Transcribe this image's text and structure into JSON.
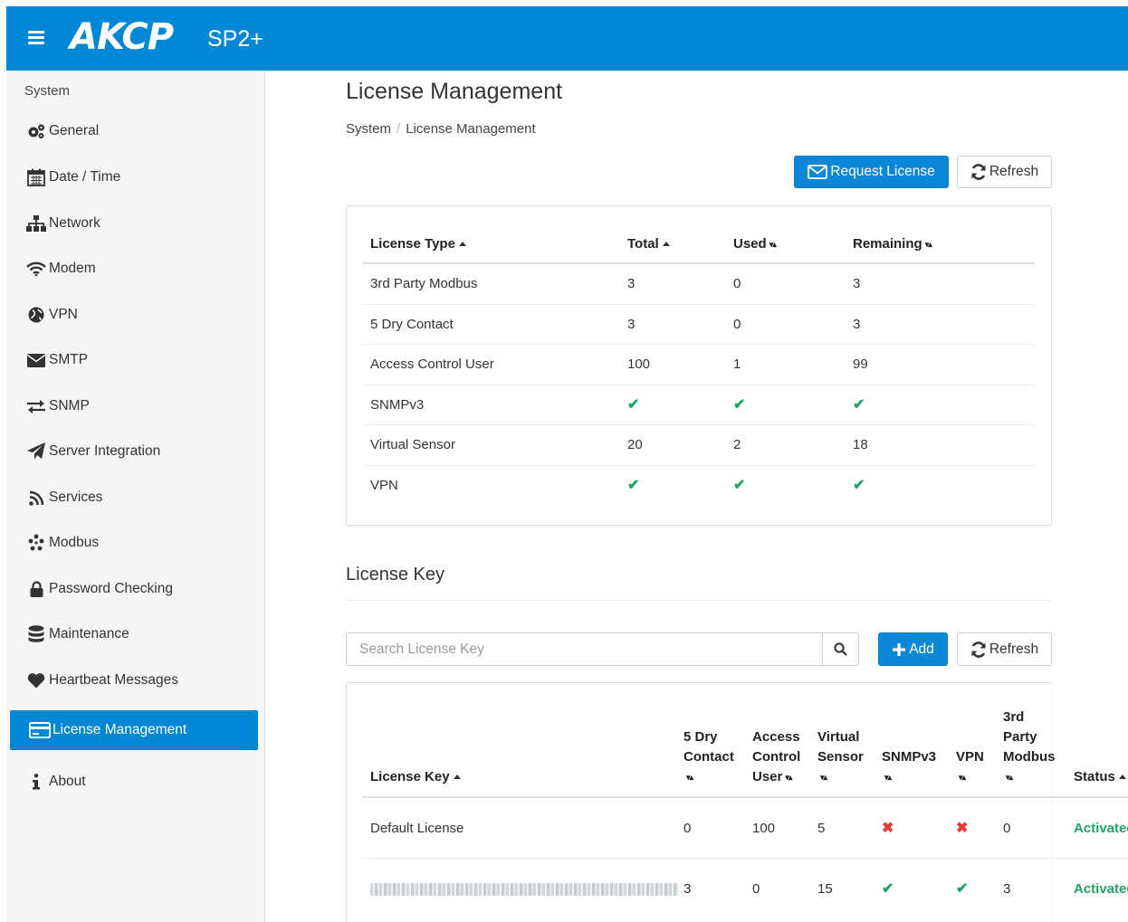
{
  "header": {
    "logo": "AKCP",
    "product": "SP2+"
  },
  "sidebar": {
    "heading": "System",
    "items": [
      {
        "label": "General",
        "icon": "gears-icon"
      },
      {
        "label": "Date / Time",
        "icon": "calendar-icon"
      },
      {
        "label": "Network",
        "icon": "sitemap-icon"
      },
      {
        "label": "Modem",
        "icon": "wifi-icon"
      },
      {
        "label": "VPN",
        "icon": "globe-icon"
      },
      {
        "label": "SMTP",
        "icon": "envelope-icon"
      },
      {
        "label": "SNMP",
        "icon": "exchange-icon"
      },
      {
        "label": "Server Integration",
        "icon": "paper-plane-icon"
      },
      {
        "label": "Services",
        "icon": "rss-icon"
      },
      {
        "label": "Modbus",
        "icon": "modbus-icon"
      },
      {
        "label": "Password Checking",
        "icon": "lock-icon"
      },
      {
        "label": "Maintenance",
        "icon": "database-icon"
      },
      {
        "label": "Heartbeat Messages",
        "icon": "heart-icon"
      },
      {
        "label": "License Management",
        "icon": "credit-card-icon",
        "active": true
      },
      {
        "label": "About",
        "icon": "info-icon"
      }
    ]
  },
  "page": {
    "title": "License Management",
    "breadcrumb": [
      "System",
      "License Management"
    ],
    "request_license": "Request License",
    "refresh": "Refresh"
  },
  "license_table": {
    "headers": [
      "License Type",
      "Total",
      "Used",
      "Remaining"
    ],
    "rows": [
      [
        "3rd Party Modbus",
        "3",
        "0",
        "3"
      ],
      [
        "5 Dry Contact",
        "3",
        "0",
        "3"
      ],
      [
        "Access Control User",
        "100",
        "1",
        "99"
      ],
      [
        "SNMPv3",
        "✔",
        "✔",
        "✔"
      ],
      [
        "Virtual Sensor",
        "20",
        "2",
        "18"
      ],
      [
        "VPN",
        "✔",
        "✔",
        "✔"
      ]
    ]
  },
  "license_key": {
    "title": "License Key",
    "search_placeholder": "Search License Key",
    "add": "Add",
    "refresh": "Refresh",
    "headers": {
      "key": "License Key",
      "dry1": "5 Dry",
      "dry2": "Contact",
      "acc1": "Access",
      "acc2": "Control",
      "acc3": "User",
      "vs1": "Virtual",
      "vs2": "Sensor",
      "snmp": "SNMPv3",
      "vpn": "VPN",
      "mb1": "3rd",
      "mb2": "Party",
      "mb3": "Modbus",
      "status": "Status"
    },
    "rows": [
      {
        "key": "Default License",
        "dry": "0",
        "acc": "100",
        "vs": "5",
        "snmp": "✖",
        "vpn": "✖",
        "mb": "0",
        "status": "Activated"
      },
      {
        "key": "",
        "dry": "3",
        "acc": "0",
        "vs": "15",
        "snmp": "✔",
        "vpn": "✔",
        "mb": "3",
        "status": "Activated"
      }
    ]
  },
  "colors": {
    "brand": "#0087d3",
    "success": "#21a366",
    "danger": "#e03b3b"
  }
}
